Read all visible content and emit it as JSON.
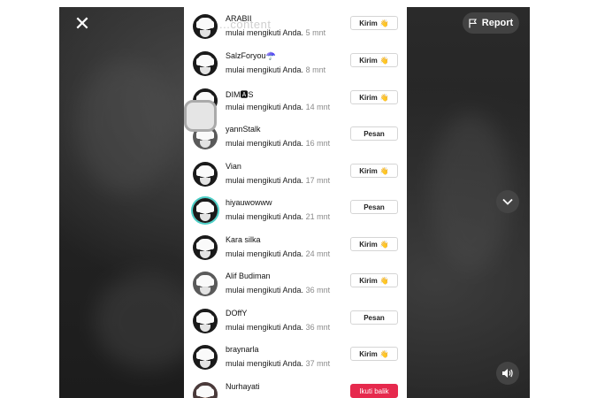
{
  "viewer": {
    "report_label": "Report",
    "overlay_title": "...content"
  },
  "followers": [
    {
      "name": "ARABII",
      "action": "mulai mengikuti Anda.",
      "time": "5 mnt",
      "button": "Kirim",
      "button_icon": "wave-emoji-icon"
    },
    {
      "name": "SalzForyou☂️",
      "action": "mulai mengikuti Anda.",
      "time": "8 mnt",
      "button": "Kirim",
      "button_icon": "wave-emoji-icon"
    },
    {
      "name": "DIM🅰S",
      "action": "mulai mengikuti Anda.",
      "time": "14 mnt",
      "button": "Kirim",
      "button_icon": "wave-emoji-icon"
    },
    {
      "name": "yannStalk",
      "action": "mulai mengikuti Anda.",
      "time": "16 mnt",
      "button": "Pesan",
      "button_icon": ""
    },
    {
      "name": "Vian",
      "action": "mulai mengikuti Anda.",
      "time": "17 mnt",
      "button": "Kirim",
      "button_icon": "wave-emoji-icon"
    },
    {
      "name": "hiyauwowww",
      "action": "mulai mengikuti Anda.",
      "time": "21 mnt",
      "button": "Pesan",
      "button_icon": ""
    },
    {
      "name": "Kara silka",
      "action": "mulai mengikuti Anda.",
      "time": "24 mnt",
      "button": "Kirim",
      "button_icon": "wave-emoji-icon"
    },
    {
      "name": "Alif Budiman",
      "action": "mulai mengikuti Anda.",
      "time": "36 mnt",
      "button": "Kirim",
      "button_icon": "wave-emoji-icon"
    },
    {
      "name": "DOffY",
      "action": "mulai mengikuti Anda.",
      "time": "36 mnt",
      "button": "Pesan",
      "button_icon": ""
    },
    {
      "name": "braynarla",
      "action": "mulai mengikuti Anda.",
      "time": "37 mnt",
      "button": "Kirim",
      "button_icon": "wave-emoji-icon"
    },
    {
      "name": "Nurhayati",
      "action": "",
      "time": "",
      "button": "Ikuti balik",
      "button_icon": ""
    }
  ],
  "colors": {
    "follow_back": "#e6294d",
    "avatar_ring": "#4dd0c8"
  }
}
